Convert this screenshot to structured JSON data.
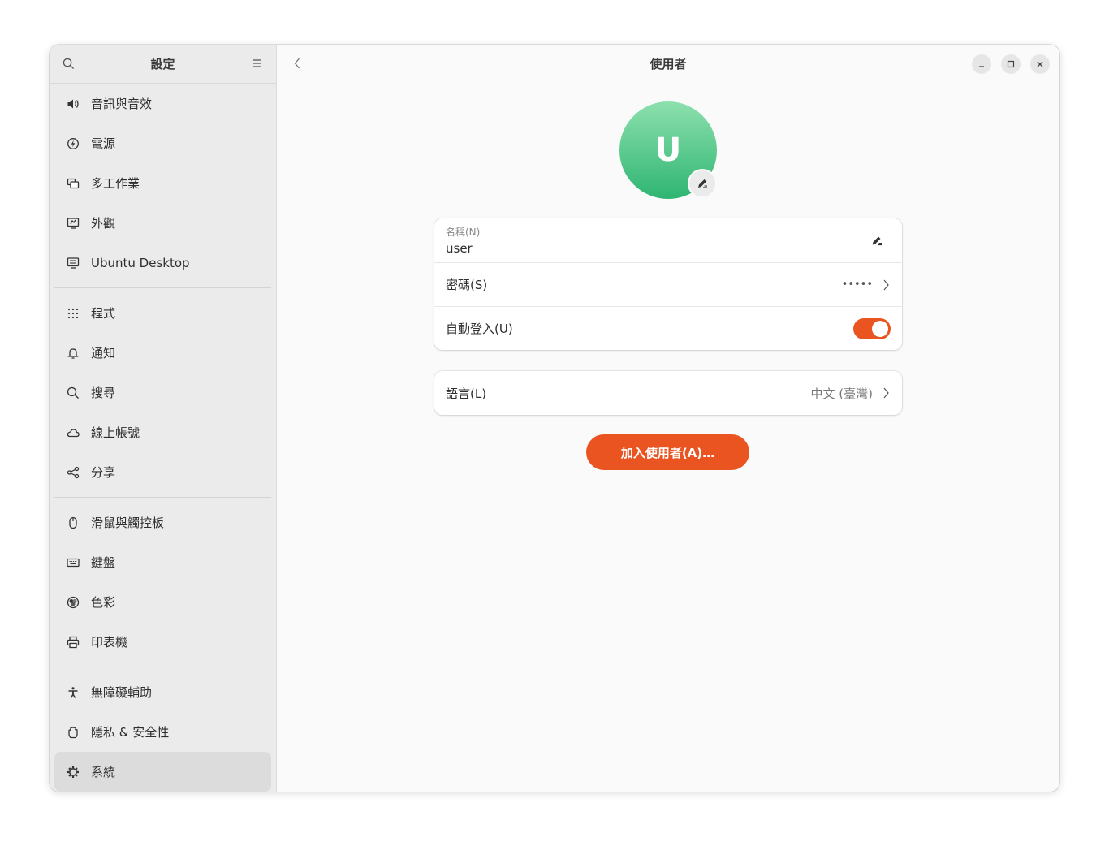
{
  "sidebar": {
    "title": "設定",
    "groups": [
      [
        {
          "icon": "speaker-icon",
          "label": "音訊與音效"
        },
        {
          "icon": "power-icon",
          "label": "電源"
        },
        {
          "icon": "multitasking-icon",
          "label": "多工作業"
        },
        {
          "icon": "appearance-icon",
          "label": "外觀"
        },
        {
          "icon": "ubuntu-desktop-icon",
          "label": "Ubuntu Desktop"
        }
      ],
      [
        {
          "icon": "apps-grid-icon",
          "label": "程式"
        },
        {
          "icon": "bell-icon",
          "label": "通知"
        },
        {
          "icon": "search-icon",
          "label": "搜尋"
        },
        {
          "icon": "cloud-icon",
          "label": "線上帳號"
        },
        {
          "icon": "share-icon",
          "label": "分享"
        }
      ],
      [
        {
          "icon": "mouse-icon",
          "label": "滑鼠與觸控板"
        },
        {
          "icon": "keyboard-icon",
          "label": "鍵盤"
        },
        {
          "icon": "color-icon",
          "label": "色彩"
        },
        {
          "icon": "printer-icon",
          "label": "印表機"
        }
      ],
      [
        {
          "icon": "accessibility-icon",
          "label": "無障礙輔助"
        },
        {
          "icon": "hand-icon",
          "label": "隱私 & 安全性"
        },
        {
          "icon": "gear-icon",
          "label": "系統",
          "active": true
        }
      ]
    ]
  },
  "main": {
    "title": "使用者",
    "avatar_letter": "U",
    "name_caption": "名稱(N)",
    "name_value": "user",
    "password_label": "密碼(S)",
    "password_dots": "•••••",
    "autologin_label": "自動登入(U)",
    "autologin_on": true,
    "language_label": "語言(L)",
    "language_value": "中文 (臺灣)",
    "add_user_label": "加入使用者(A)…"
  },
  "colors": {
    "accent": "#e95420",
    "avatar_top": "#8de0ad",
    "avatar_bottom": "#2fb572"
  }
}
